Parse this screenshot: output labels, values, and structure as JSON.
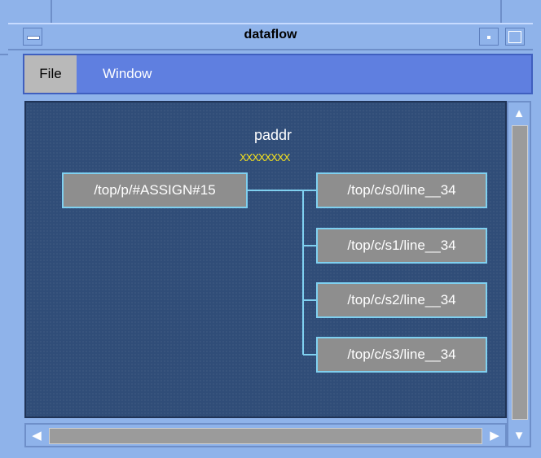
{
  "window": {
    "title": "dataflow"
  },
  "menu": {
    "file": "File",
    "window": "Window"
  },
  "diagram": {
    "signal_name": "paddr",
    "signal_value": "XXXXXXXX",
    "source": "/top/p/#ASSIGN#15",
    "targets": [
      "/top/c/s0/line__34",
      "/top/c/s1/line__34",
      "/top/c/s2/line__34",
      "/top/c/s3/line__34"
    ]
  },
  "icons": {
    "menu": "system-menu-icon",
    "minimize": "minimize-icon",
    "maximize": "maximize-icon",
    "up": "arrow-up-icon",
    "down": "arrow-down-icon",
    "left": "arrow-left-icon",
    "right": "arrow-right-icon"
  }
}
